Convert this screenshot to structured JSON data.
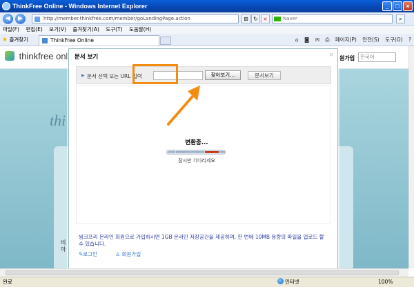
{
  "window": {
    "title": "ThinkFree Online - Windows Internet Explorer"
  },
  "address": {
    "url": "http://member.thinkfree.com/member/goLandingPage.action"
  },
  "search": {
    "provider": "Naver"
  },
  "menu": [
    "파일(F)",
    "편집(E)",
    "보기(V)",
    "즐겨찾기(A)",
    "도구(T)",
    "도움말(H)"
  ],
  "favorites": {
    "label": "즐겨찾기"
  },
  "tab": {
    "label": "ThinkFree Online"
  },
  "toolbar_right": [
    "페이지(P)",
    "안전(S)",
    "도구(O)"
  ],
  "site": {
    "logo": "thinkfree onli",
    "signup": "원가입",
    "language": "한국어",
    "hero": "thi",
    "side_text": [
      "비",
      "아"
    ]
  },
  "modal": {
    "title": "문서 보기",
    "close": "×",
    "panel_label": "문서 선택 또는 URL 입력",
    "browse_button": "찾아보기...",
    "view_button": "문서보기",
    "converting": "변환중...",
    "wait": "잠시만 기다리세요",
    "info": "씽크프리 온라인 회원으로 가입하시면 1GB 온라인 저장공간을 제공하며, 한 번에 10MB 용량의 파일을 업로드 할 수 있습니다.",
    "links": {
      "login": "로그인",
      "signup": "회원가입"
    },
    "progress": {
      "segments": 8,
      "active": [
        5,
        6
      ]
    }
  },
  "status": {
    "text": "완료",
    "zone": "인터넷",
    "zoom": "100%"
  },
  "colors": {
    "highlight": "#f28c12",
    "arrow": "#f28c12"
  }
}
